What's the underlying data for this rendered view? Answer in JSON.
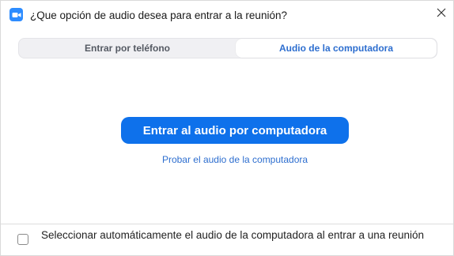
{
  "window": {
    "title": "¿Que opción de audio desea para entrar a la reunión?",
    "close_glyph": "✕"
  },
  "tabs": [
    {
      "label": "Entrar por teléfono",
      "selected": false
    },
    {
      "label": "Audio de la computadora",
      "selected": true
    }
  ],
  "main": {
    "join_button_label": "Entrar al audio por computadora",
    "test_link_label": "Probar el audio de la computadora"
  },
  "footer": {
    "auto_select_label": "Seleccionar automáticamente el audio de la computadora al entrar a una reunión",
    "auto_select_checked": false
  },
  "colors": {
    "accent": "#0e71eb",
    "link": "#2d6ecf",
    "app_icon": "#2d8cff"
  },
  "icons": {
    "app": "zoom-camera-icon",
    "close": "close-icon"
  }
}
